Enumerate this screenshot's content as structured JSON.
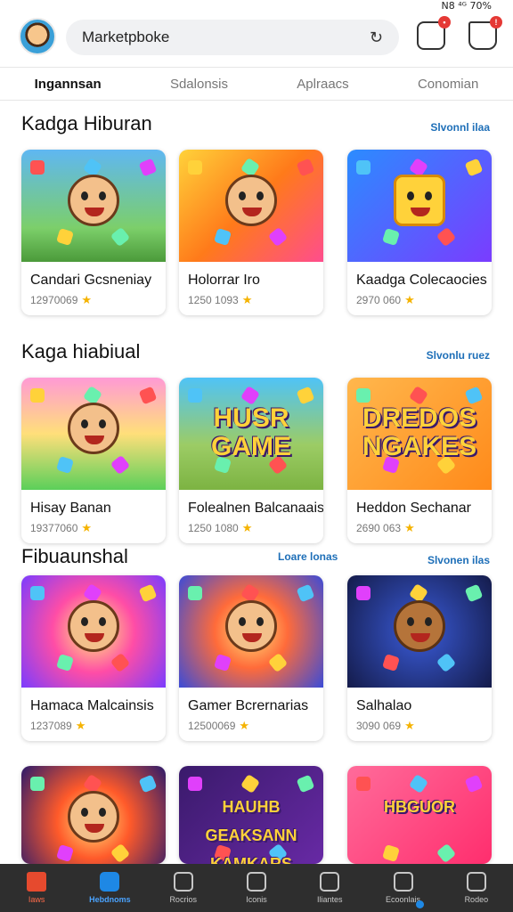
{
  "status": {
    "text": "N8  ⁴ᴳ 70%"
  },
  "search": {
    "value": "Marketpboke"
  },
  "tabs": [
    {
      "label": "Ingannsan",
      "active": true
    },
    {
      "label": "Sdalonsis",
      "active": false
    },
    {
      "label": "Aplraacs",
      "active": false
    },
    {
      "label": "Conomian",
      "active": false
    }
  ],
  "sections": [
    {
      "title": "Kadga Hiburan",
      "link": "Slvonnl ilaa",
      "cards": [
        {
          "name": "Candari Gcsneniay",
          "meta": "12970069",
          "art": "hero"
        },
        {
          "name": "Holorrar Iro",
          "meta": "1250 1093",
          "art": "hero2"
        },
        {
          "name": "Kaadga Colecaocies",
          "meta": "2970 060",
          "art": "dice"
        }
      ]
    },
    {
      "title": "Kaga hiabiual",
      "link": "Slvonlu ruez",
      "cards": [
        {
          "name": "Hisay Banan",
          "meta": "19377060",
          "art": "hero3"
        },
        {
          "name": "Folealnen Balcanaais",
          "meta": "1250 1080",
          "art": "HUSR GAME"
        },
        {
          "name": "Heddon Sechanar",
          "meta": "2690 063",
          "art": "DREDOS NGAKES"
        }
      ]
    },
    {
      "title": "Fibuaunshal",
      "link_mid": "Loare lonas",
      "link": "Slvonen ilas",
      "cards": [
        {
          "name": "Hamaca Malcainsis",
          "meta": "1237089",
          "art": "hero4"
        },
        {
          "name": "Gamer Bcrernarias",
          "meta": "12500069",
          "art": "heroes"
        },
        {
          "name": "Salhalao",
          "meta": "3090 069",
          "art": "bear"
        }
      ]
    },
    {
      "title": "",
      "cards": [
        {
          "name": "",
          "meta": "",
          "art": "hero5"
        },
        {
          "name": "",
          "meta": "HAUHB GEAKSANN KAMKARS",
          "art": "text"
        },
        {
          "name": "",
          "meta": "HBGUOR",
          "art": "text2"
        }
      ]
    }
  ],
  "nav": [
    {
      "label": "Iaws",
      "cls": "home"
    },
    {
      "label": "Hebdnoms",
      "cls": "active"
    },
    {
      "label": "Rocrios",
      "cls": ""
    },
    {
      "label": "Iconis",
      "cls": ""
    },
    {
      "label": "Iliantes",
      "cls": ""
    },
    {
      "label": "Ecoonlais",
      "cls": "dot"
    },
    {
      "label": "Rodeo",
      "cls": ""
    }
  ],
  "colors": {
    "accent": "#1e88e5",
    "link": "#1e6fb8",
    "star": "#f5b301",
    "nav_bg": "#2e2e2e"
  }
}
